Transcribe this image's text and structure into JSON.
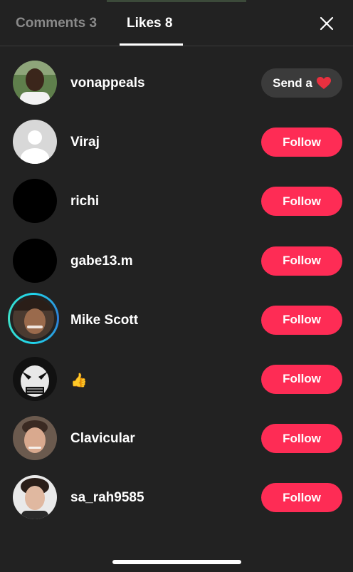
{
  "tabs": {
    "comments_label": "Comments 3",
    "likes_label": "Likes 8"
  },
  "users": [
    {
      "username": "vonappeals",
      "action": "Send a",
      "action_icon": "heart-icon"
    },
    {
      "username": "Viraj",
      "action": "Follow"
    },
    {
      "username": "richi",
      "action": "Follow"
    },
    {
      "username": "gabe13.m",
      "action": "Follow"
    },
    {
      "username": "Mike Scott",
      "action": "Follow",
      "story_ring": true
    },
    {
      "username": "👍",
      "action": "Follow"
    },
    {
      "username": "Clavicular",
      "action": "Follow"
    },
    {
      "username": "sa_rah9585",
      "action": "Follow"
    }
  ],
  "colors": {
    "follow": "#fe2c55",
    "background": "#222222",
    "send_button": "#3b3b3b",
    "story_ring": "#20d5ec"
  }
}
